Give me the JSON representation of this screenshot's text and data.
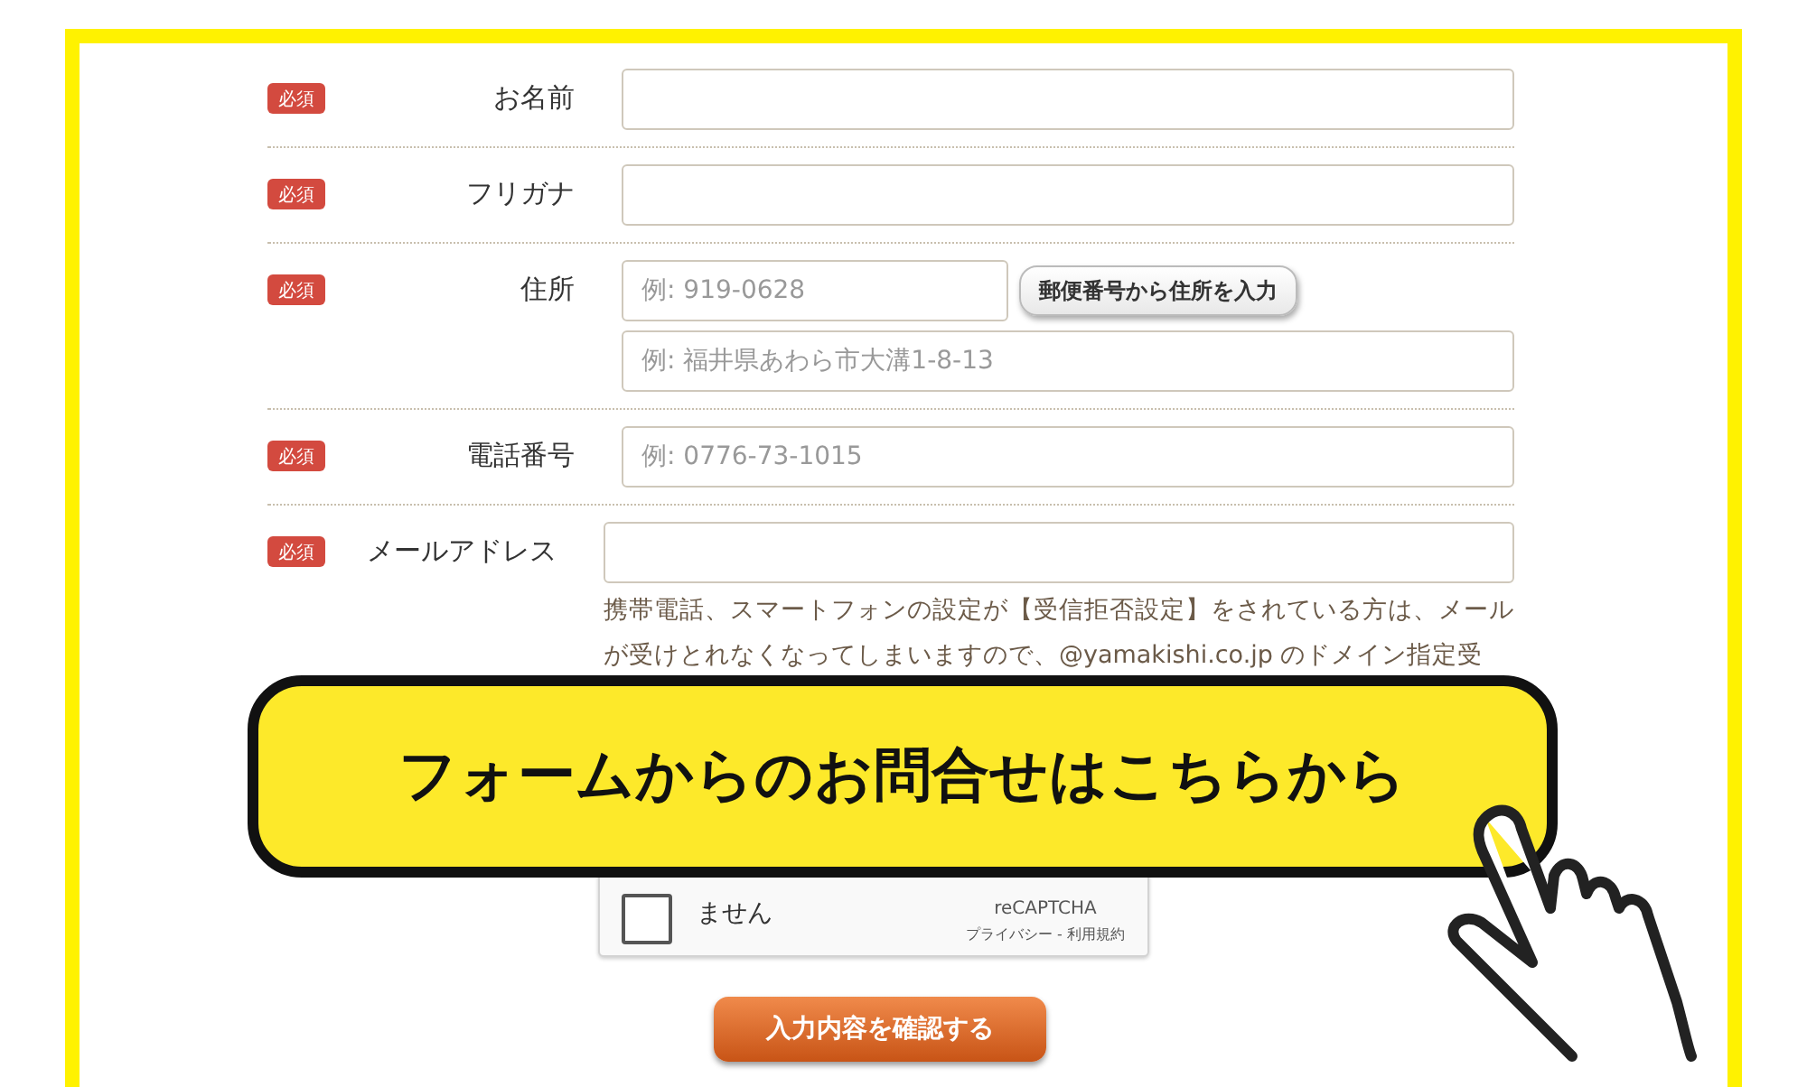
{
  "form": {
    "fields": [
      {
        "required": true,
        "badge": "必須",
        "label": "お名前",
        "lines": [
          [
            {
              "kind": "text"
            }
          ]
        ]
      },
      {
        "required": true,
        "badge": "必須",
        "label": "フリガナ",
        "lines": [
          [
            {
              "kind": "text"
            }
          ]
        ]
      },
      {
        "required": true,
        "badge": "必須",
        "label": "住所",
        "lines": [
          [
            {
              "kind": "text",
              "placeholder": "例: 919-0628"
            },
            {
              "kind": "button",
              "label": "郵便番号から住所を入力"
            }
          ],
          [
            {
              "kind": "text",
              "placeholder": "例: 福井県あわら市大溝1-8-13"
            }
          ]
        ]
      },
      {
        "required": true,
        "badge": "必須",
        "label": "電話番号",
        "lines": [
          [
            {
              "kind": "text",
              "placeholder": "例: 0776-73-1015"
            }
          ]
        ]
      },
      {
        "required": true,
        "badge": "必須",
        "label": "メールアドレス",
        "lines": [
          [
            {
              "kind": "text"
            }
          ]
        ],
        "note_lines": [
          "携帯電話、スマートフォンの設定が【受信拒否設定】をされている方は、メール",
          "が受けとれなくなってしまいますので、@yamakishi.co.jp のドメイン指定受"
        ]
      }
    ],
    "captcha": {
      "checked": false,
      "label": "ません",
      "brand": "reCAPTCHA",
      "links": "プライバシー - 利用規約"
    },
    "submit": "入力内容を確認する"
  },
  "banner": {
    "text": "フォームからのお問合せはこちらから"
  }
}
